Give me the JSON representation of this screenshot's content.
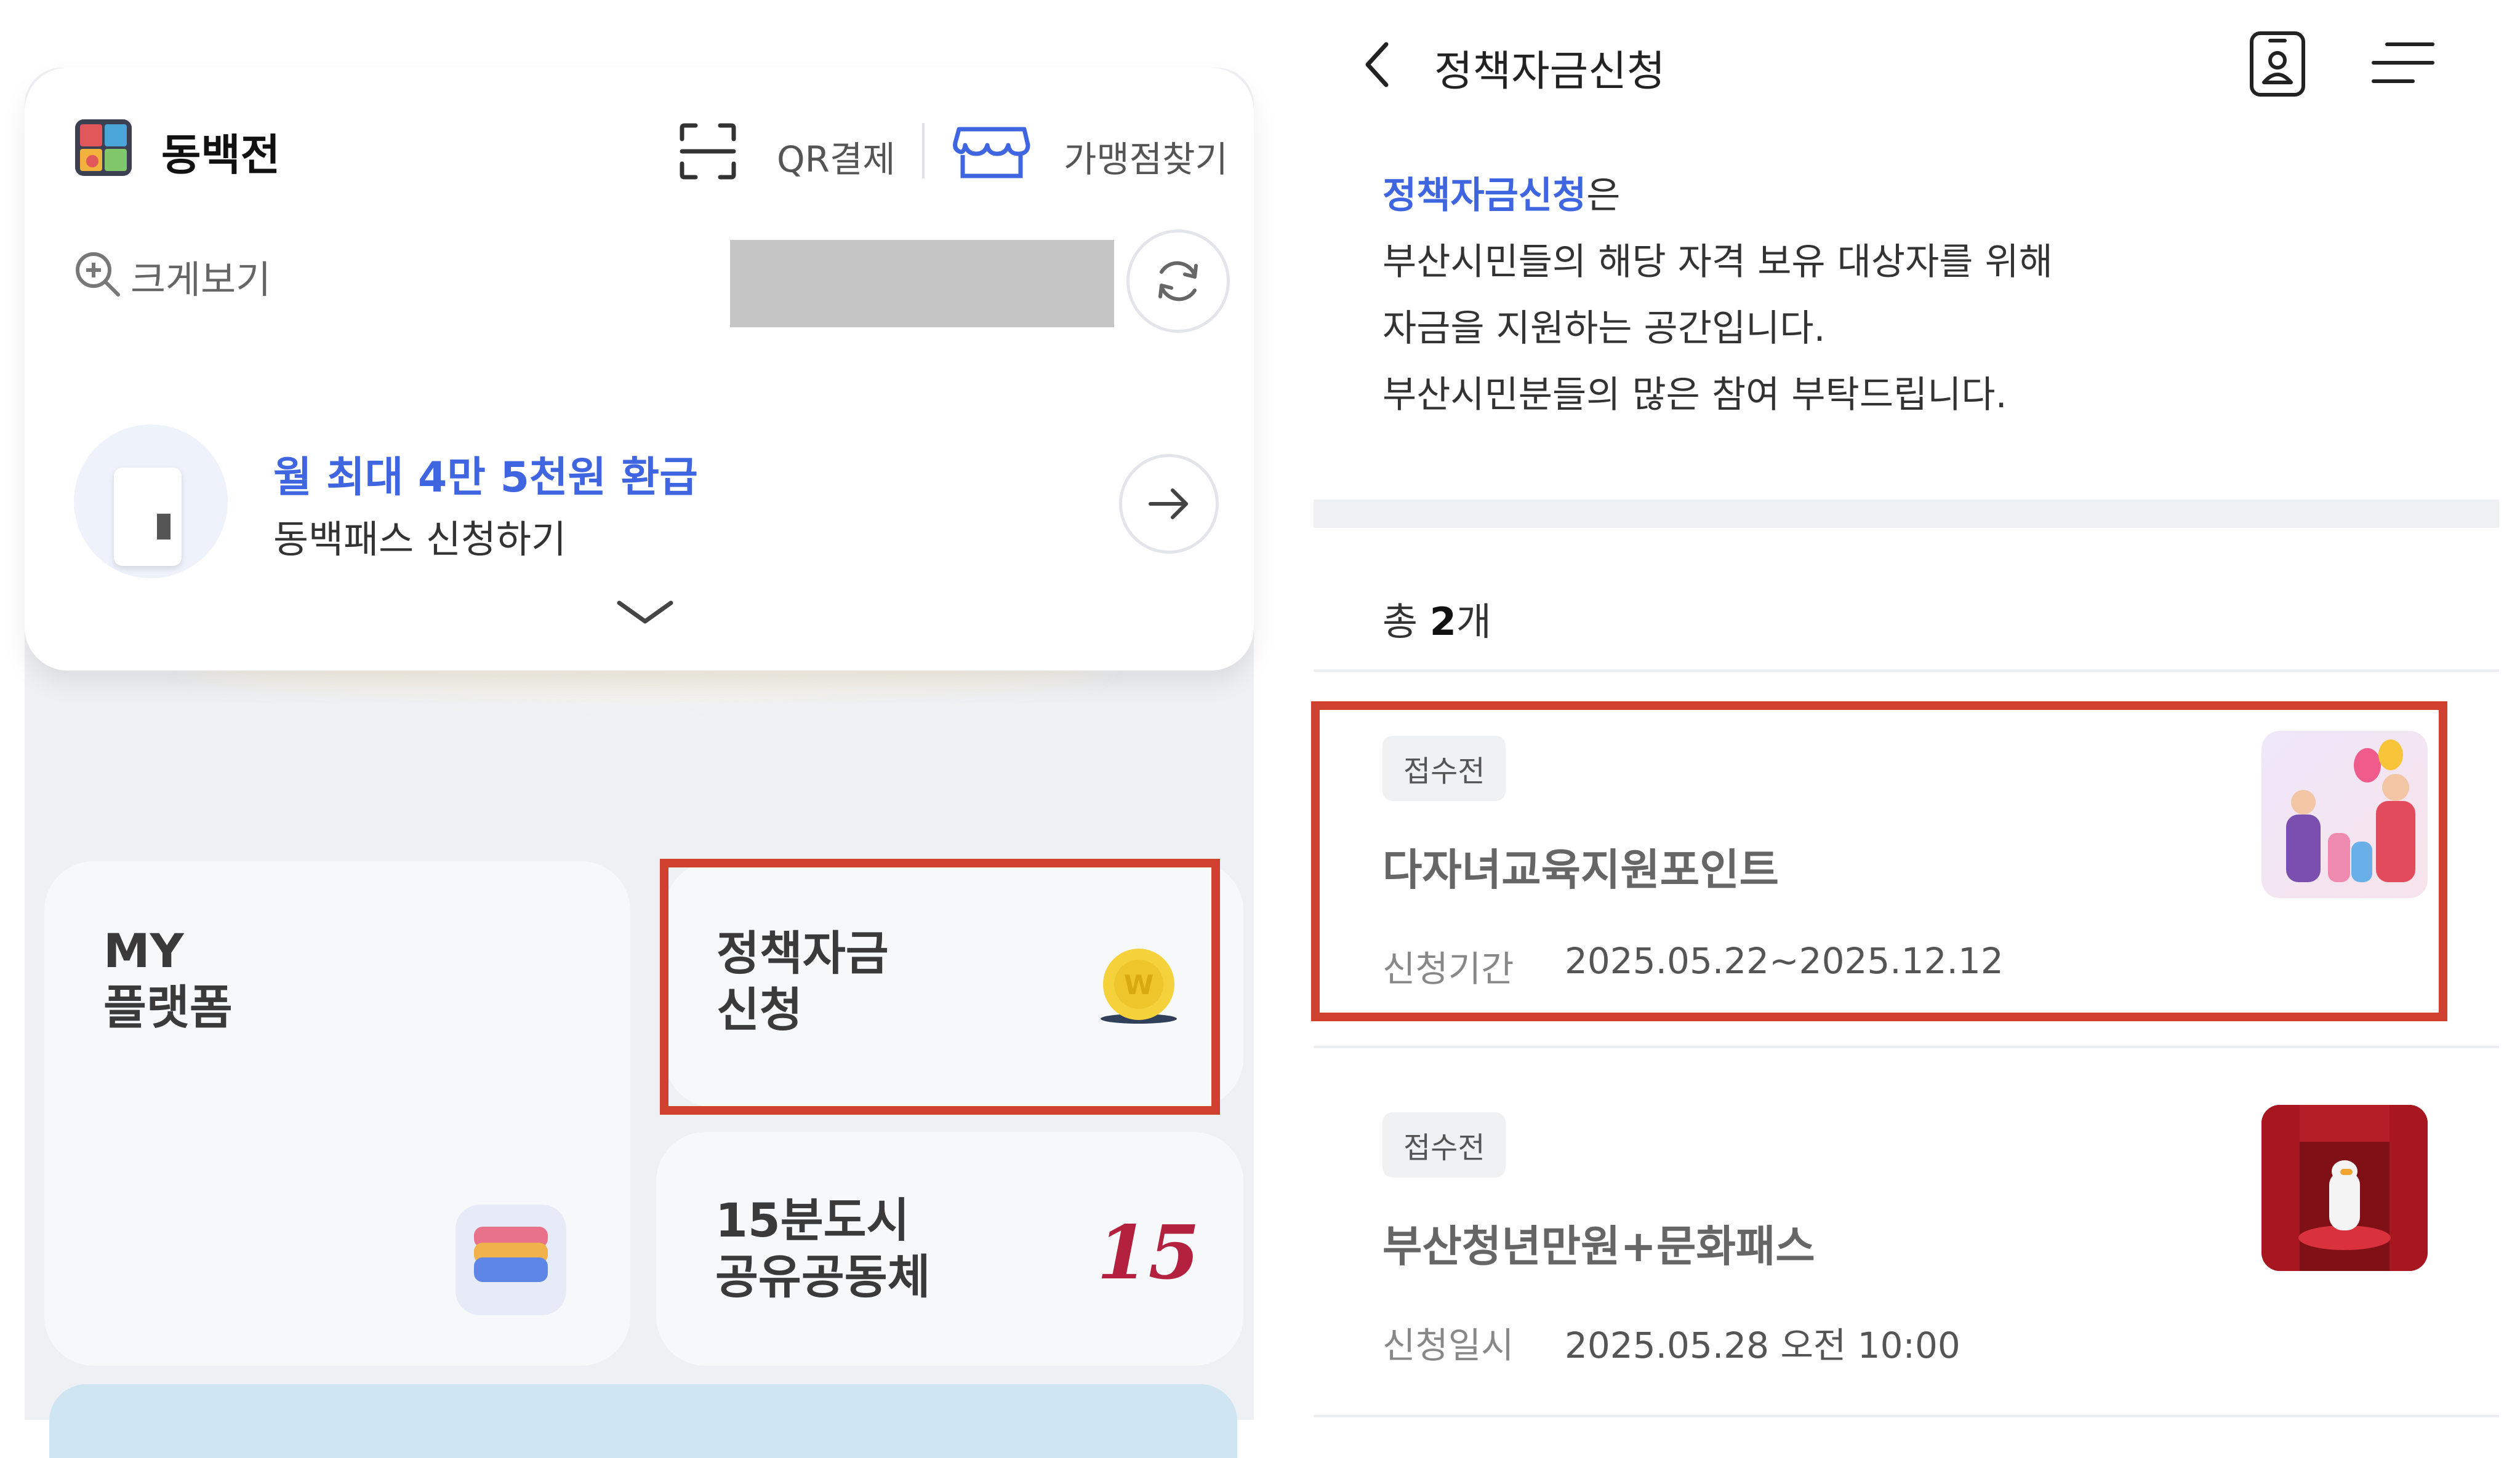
{
  "left_app": {
    "app_name": "동백전",
    "qr_label": "QR결제",
    "store_label": "가맹점찾기",
    "zoom_label": "크게보기",
    "promo": {
      "title": "월 최대 4만 5천원 환급",
      "subtitle": "동백패스 신청하기"
    },
    "tiles": {
      "my_platform": "MY\n플랫폼",
      "policy_funds": "정책자금\n신청",
      "city15": "15분도시\n공유공동체"
    },
    "city15_logo_text": "15"
  },
  "right_page": {
    "title": "정책자금신청",
    "intro": {
      "accent": "정책자금신청",
      "suffix": "은",
      "lines": [
        "부산시민들의 해당 자격 보유 대상자를 위해",
        "자금을 지원하는 공간입니다.",
        "부산시민분들의 많은 참여 부탁드립니다."
      ]
    },
    "total": {
      "prefix": "총 ",
      "count": "2",
      "suffix": "개"
    },
    "items": [
      {
        "badge": "접수전",
        "title": "다자녀교육지원포인트",
        "meta_label": "신청기간",
        "meta_value": "2025.05.22~2025.12.12"
      },
      {
        "badge": "접수전",
        "title": "부산청년만원+문화패스",
        "meta_label": "신청일시",
        "meta_value": "2025.05.28 오전 10:00"
      }
    ]
  },
  "colors": {
    "accent_blue": "#3f66e0",
    "highlight_red": "#d0402f"
  },
  "icons": [
    "logo-icon",
    "qr-scan-icon",
    "store-icon",
    "zoom-in-icon",
    "refresh-icon",
    "arrow-right-icon",
    "chevron-down-icon",
    "coin-icon",
    "wallet-icon",
    "back-arrow-icon",
    "id-card-icon",
    "menu-icon"
  ]
}
